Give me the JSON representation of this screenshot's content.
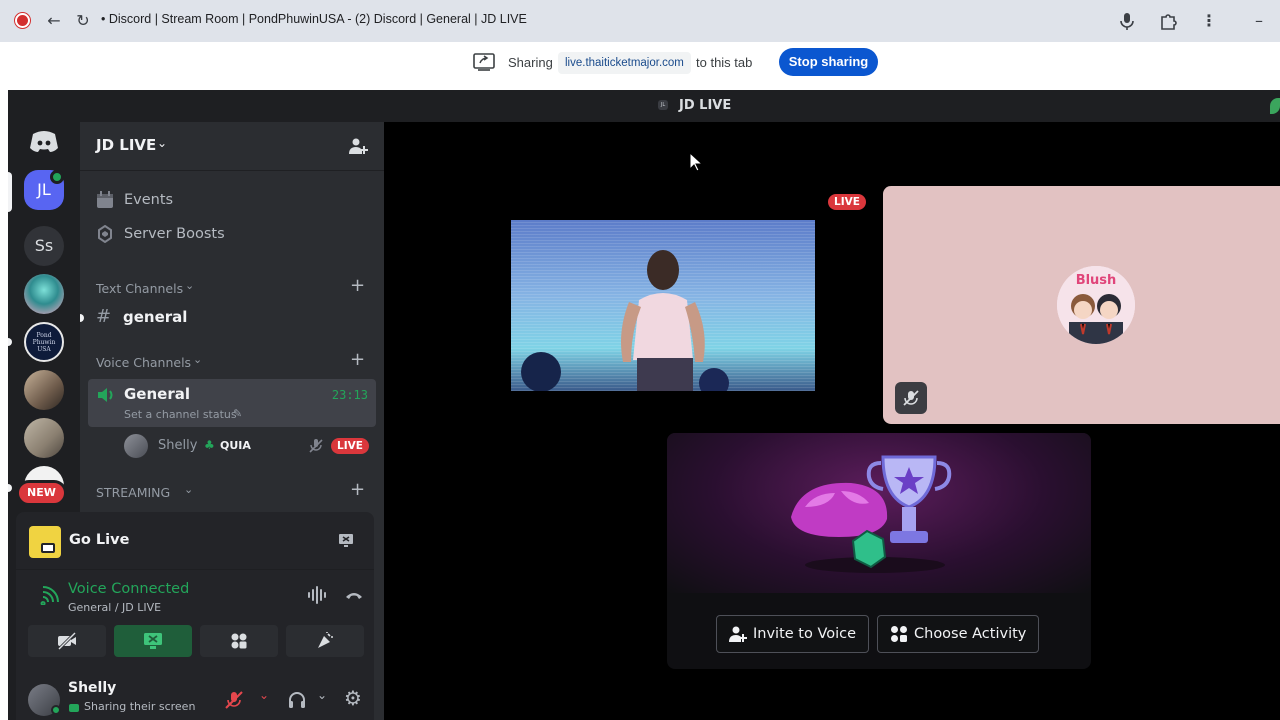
{
  "browser": {
    "title": "• Discord | Stream Room | PondPhuwinUSA - (2) Discord | General | JD LIVE"
  },
  "share_bar": {
    "sharing_label": "Sharing",
    "url": "live.thaiticketmajor.com",
    "suffix": "to this tab",
    "stop_label": "Stop sharing",
    "button_color": "#0b57d0"
  },
  "topbar": {
    "server_chip": "JL",
    "server_name": "JD LIVE"
  },
  "rail": {
    "servers": [
      {
        "initials": "JL",
        "color": "#5865f2",
        "selected": true
      },
      {
        "initials": "Ss",
        "color": "#313338"
      }
    ],
    "new_badge": "NEW"
  },
  "sidebar": {
    "guild_name": "JD LIVE",
    "items": [
      {
        "label": "Events",
        "icon": "calendar-icon"
      },
      {
        "label": "Server Boosts",
        "icon": "boost-icon"
      }
    ],
    "text_category": "Text Channels",
    "text_channel": "general",
    "voice_category": "Voice Channels",
    "voice_channel": {
      "name": "General",
      "time": "23:13",
      "status": "Set a channel status"
    },
    "voice_user": {
      "name": "Shelly",
      "tag": "QUIA",
      "live": "LIVE"
    },
    "streaming_category": "STREAMING"
  },
  "golive": {
    "title": "Go Live"
  },
  "voice_connected": {
    "title": "Voice Connected",
    "subtitle": "General / JD LIVE",
    "accent": "#23a55a"
  },
  "user_panel": {
    "name": "Shelly",
    "status": "Sharing their screen"
  },
  "stage": {
    "live_badge": "LIVE",
    "invite_label": "Invite to Voice",
    "activity_label": "Choose Activity"
  }
}
